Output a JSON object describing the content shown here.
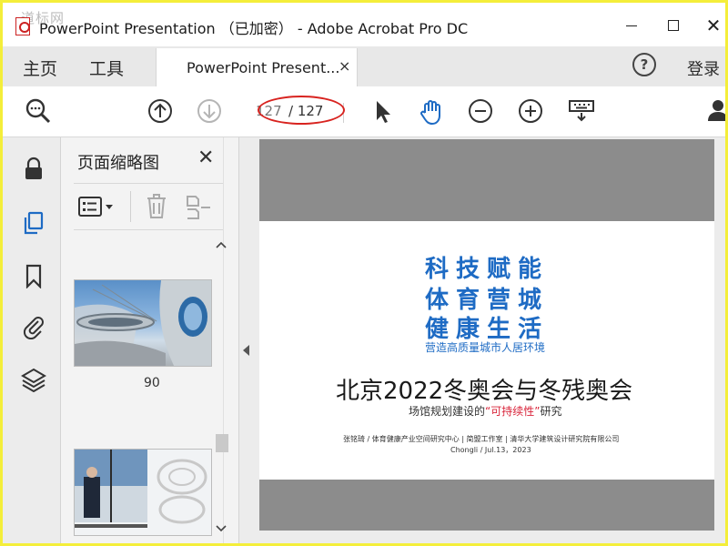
{
  "window": {
    "title": "PowerPoint Presentation （已加密） - Adobe Acrobat Pro DC",
    "watermark": "道标网",
    "close_glyph": "✕"
  },
  "tabs": {
    "home": "主页",
    "tools": "工具",
    "document": "PowerPoint Present...",
    "close_glyph": "×",
    "help": "?",
    "signin": "登录"
  },
  "toolbar": {
    "page_current": "127",
    "page_total": "/ 127",
    "icons": [
      "zoom-search-icon",
      "page-up-icon",
      "page-down-icon",
      "select-cursor-icon",
      "hand-tool-icon",
      "zoom-out-icon",
      "zoom-in-icon",
      "keyboard-icon",
      "share-user-icon"
    ]
  },
  "left_rail": {
    "icons": [
      "lock-icon",
      "pages-icon",
      "bookmark-icon",
      "attachment-icon",
      "layers-icon"
    ]
  },
  "thumbnails": {
    "title": "页面缩略图",
    "close_glyph": "✕",
    "items": [
      {
        "label": "90"
      },
      {
        "label": ""
      }
    ]
  },
  "slide": {
    "line1": "科技赋能",
    "line2": "体育营城",
    "line3": "健康生活",
    "tagline": "营造高质量城市人居环境",
    "main_title": "北京2022冬奥会与冬残奥会",
    "subtitle_pre": "场馆规划建设的",
    "subtitle_highlight": "“可持续性”",
    "subtitle_post": "研究",
    "authors": "张铭琦 / 体育健康产业空间研究中心 | 简盟工作室 | 清华大学建筑设计研究院有限公司",
    "date": "Chongli / Jul.13，2023"
  },
  "colors": {
    "accent_blue": "#1e6bc4",
    "highlight_red": "#d9243a",
    "annotation_red": "#d8231f",
    "frame_yellow": "#f4ee3a"
  }
}
